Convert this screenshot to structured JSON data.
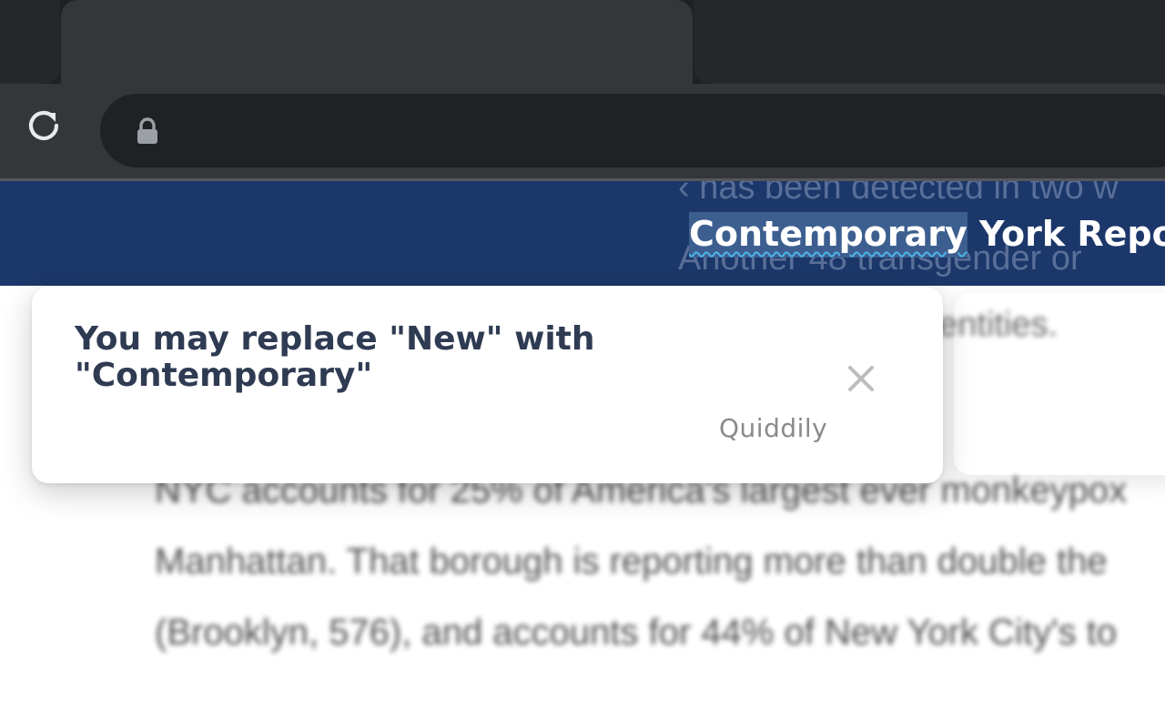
{
  "browser": {
    "tab_close_icon": "close-icon",
    "reload_icon": "reload-icon",
    "lock_icon": "lock-icon",
    "traffic_light_color": "#2bc840"
  },
  "page": {
    "header": {
      "title_highlighted_word": "Contemporary",
      "title_rest": " York Reports",
      "background_color": "#1c3769",
      "ghost_line_1": "‹ has been detected in two w",
      "ghost_line_2": "Another 48 transgender or"
    },
    "body_blurred": {
      "side_fragment": "dentities.",
      "lines": [
        "NYC accounts for 25% of America's largest  ever monkeypox",
        "Manhattan. That borough is reporting more than double the",
        "(Brooklyn, 576), and accounts for 44% of New York City's to"
      ]
    }
  },
  "suggestion_popup": {
    "message": "You may replace \"New\" with \"Contemporary\"",
    "brand": "Quiddily",
    "close_icon": "close-icon"
  }
}
